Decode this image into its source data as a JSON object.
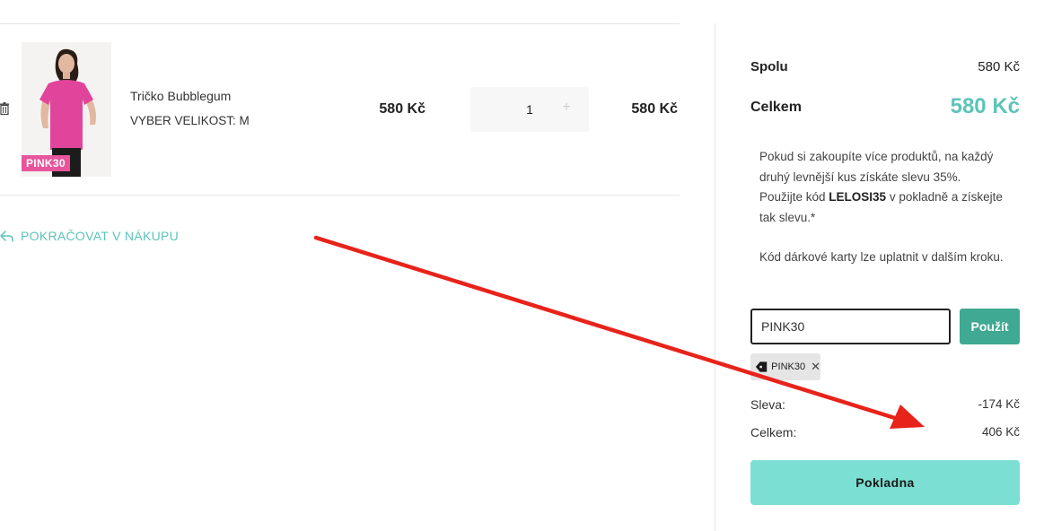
{
  "cart": {
    "item": {
      "name": "Tričko Bubblegum",
      "size_label": "VYBER VELIKOST: M",
      "badge": "PINK30",
      "unit_price": "580 Kč",
      "quantity": "1",
      "plus_symbol": "+",
      "line_total": "580 Kč"
    },
    "continue_label": "POKRAČOVAT V NÁKUPU"
  },
  "summary": {
    "subtotal_label": "Spolu",
    "subtotal_value": "580 Kč",
    "total_label": "Celkem",
    "total_value": "580 Kč",
    "promo_line1": "Pokud si zakoupíte více produktů, na každý druhý levnější kus získáte slevu 35%.",
    "promo_line2_pre": "Použijte kód ",
    "promo_code": "LELOSI35",
    "promo_line2_post": " v pokladně a získejte tak slevu.*",
    "gift_note": "Kód dárkové karty lze uplatnit v dalším kroku.",
    "coupon_value": "PINK30",
    "apply_label": "Použít",
    "applied_tag": "PINK30",
    "discount_label": "Sleva:",
    "discount_value": "-174 Kč",
    "final_label": "Celkem:",
    "final_value": "406 Kč",
    "checkout_label": "Pokladna"
  },
  "colors": {
    "accent": "#5cc4b8",
    "apply_button": "#3fa993",
    "checkout_button": "#7be0d3",
    "badge": "#e8559c",
    "annotation_arrow": "#e8231a"
  },
  "icons": {
    "remove": "trash-icon",
    "continue": "return-arrow-icon",
    "tag": "price-tag-icon",
    "tag_remove": "close-icon"
  }
}
